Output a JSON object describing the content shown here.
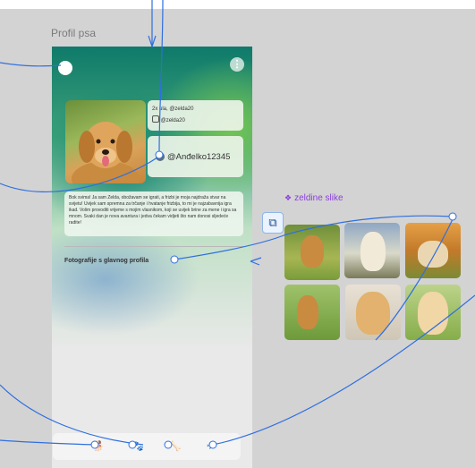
{
  "frame": {
    "title": "Profil psa"
  },
  "profile": {
    "info_line1": "2x ula, @zelda20",
    "info_line2": "@zelda20",
    "username": "@Anđelko12345",
    "bio": "Bok svima! Ja sam Zelda, obožavam se igrati, a frizbi je moja najdraža stvar na svijetu! Uvijek sam spremna za trčanje i hvatanje frizbija, to mi je najzabavnija igra ikad. Volim provoditi vrijeme s mojim vlasnikom, koji se uvijek brine za mene i igra sa mnom. Svaki dan je nova avantura i jedva čekam vidjeti što nam donosi sljedeće radite!",
    "section_title": "Fotografije s glavnog profila"
  },
  "header": {
    "menu_label": "⋮"
  },
  "gallery": {
    "title": "zeldine slike",
    "title_icon": "diamond-icon"
  },
  "nav": {
    "items": [
      {
        "icon": "dog-icon",
        "glyph": "🐕"
      },
      {
        "icon": "paw-icon",
        "glyph": "🐾"
      },
      {
        "icon": "bone-icon",
        "glyph": "🦴"
      },
      {
        "icon": "plane-icon",
        "glyph": "✈"
      }
    ]
  },
  "colors": {
    "accent": "#8a3fdc",
    "connector": "#2f6fe0",
    "gradient_start": "#0f7a6a",
    "gradient_end": "#8fd06a"
  }
}
